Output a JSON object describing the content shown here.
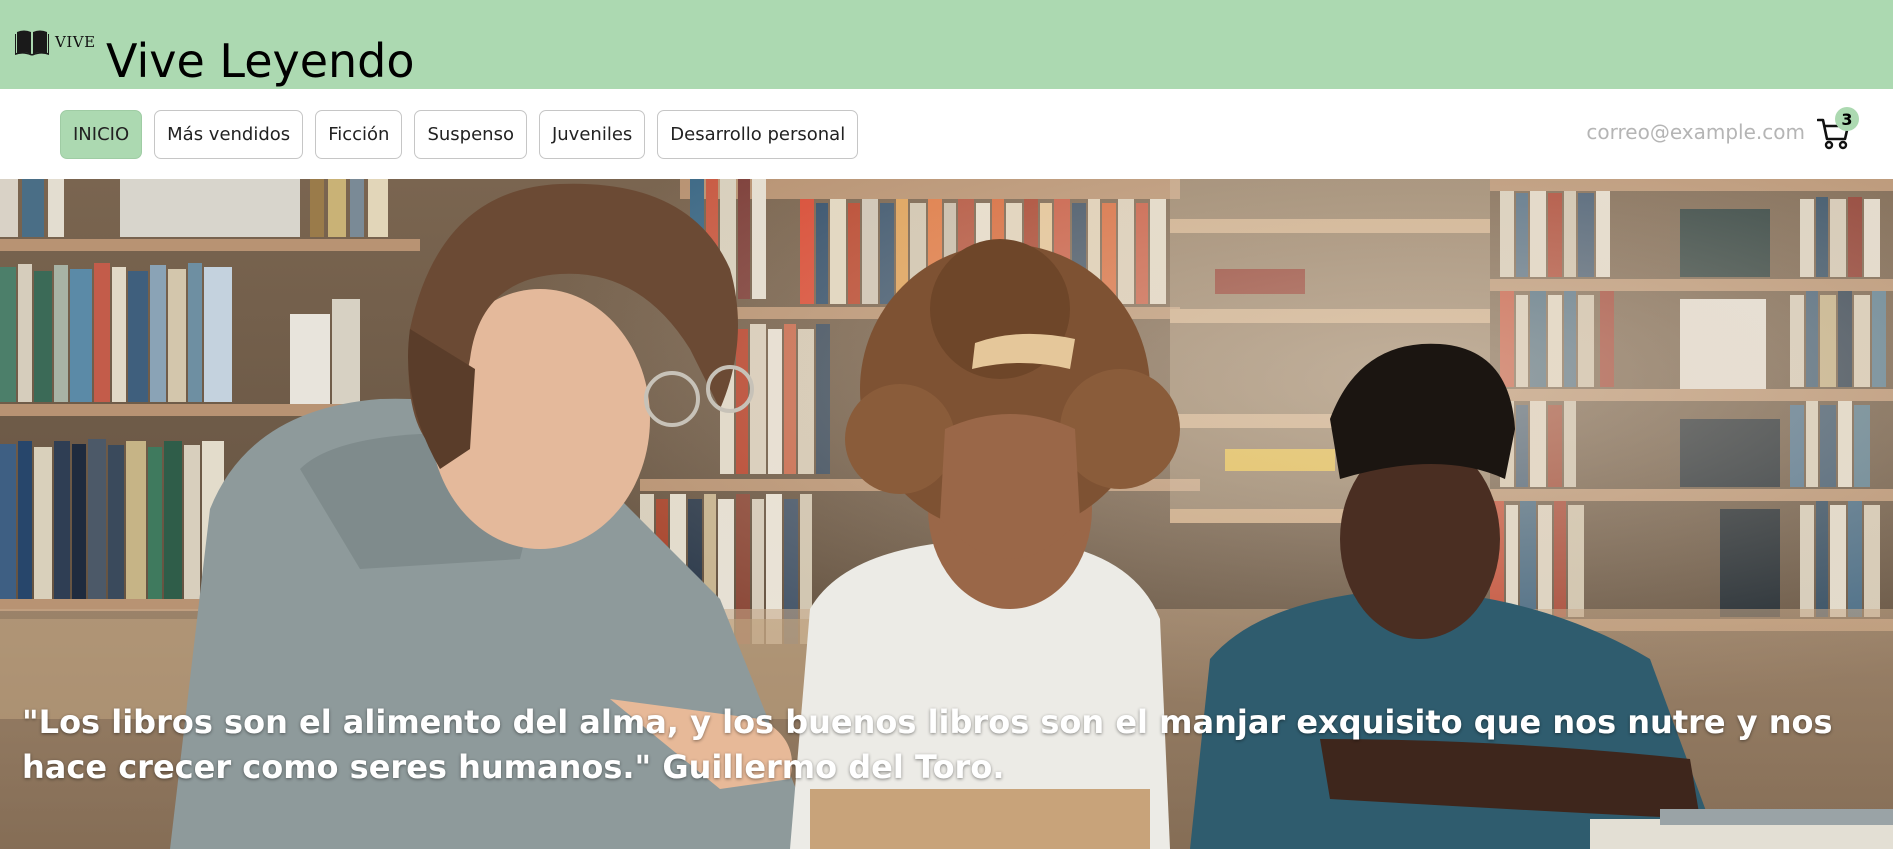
{
  "header": {
    "logo_icon": "open-book-icon",
    "logo_small_text": "VIVE",
    "title": "Vive Leyendo",
    "background_color": "#acd9b1"
  },
  "nav": {
    "items": [
      {
        "label": "INICIO",
        "active": true
      },
      {
        "label": "Más vendidos",
        "active": false
      },
      {
        "label": "Ficción",
        "active": false
      },
      {
        "label": "Suspenso",
        "active": false
      },
      {
        "label": "Juveniles",
        "active": false
      },
      {
        "label": "Desarrollo personal",
        "active": false
      }
    ],
    "email_placeholder": "correo@example.com",
    "cart": {
      "icon": "shopping-cart-icon",
      "count": "3"
    }
  },
  "hero": {
    "quote": "\"Los libros son el alimento del alma, y los buenos libros son el manjar exquisito que nos nutre y nos hace crecer como seres humanos.\" Guillermo del Toro."
  }
}
